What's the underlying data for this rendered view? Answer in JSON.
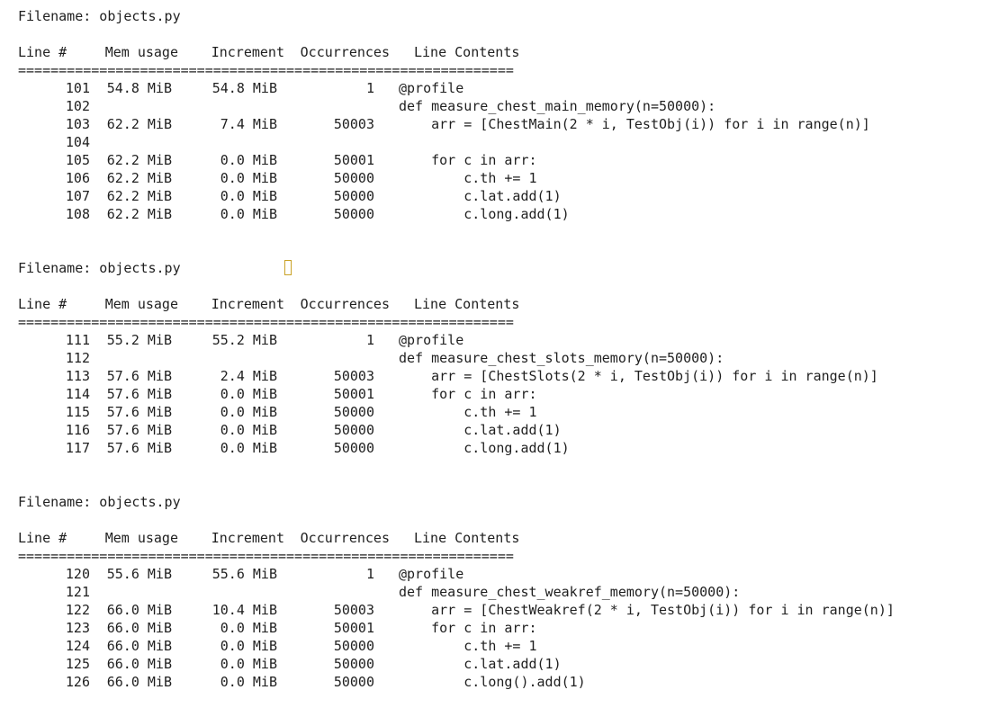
{
  "header": {
    "line_no": "Line #",
    "mem_usage": "Mem usage",
    "increment": "Increment",
    "occurrences": "Occurrences",
    "line_contents": "Line Contents",
    "separator": "============================================================="
  },
  "sections": [
    {
      "filename_label": "Filename: objects.py",
      "rows": [
        {
          "line": "101",
          "mem": "54.8 MiB",
          "incr": "54.8 MiB",
          "occ": "1",
          "code": "@profile"
        },
        {
          "line": "102",
          "mem": "",
          "incr": "",
          "occ": "",
          "code": "def measure_chest_main_memory(n=50000):"
        },
        {
          "line": "103",
          "mem": "62.2 MiB",
          "incr": "7.4 MiB",
          "occ": "50003",
          "code": "    arr = [ChestMain(2 * i, TestObj(i)) for i in range(n)]"
        },
        {
          "line": "104",
          "mem": "",
          "incr": "",
          "occ": "",
          "code": ""
        },
        {
          "line": "105",
          "mem": "62.2 MiB",
          "incr": "0.0 MiB",
          "occ": "50001",
          "code": "    for c in arr:"
        },
        {
          "line": "106",
          "mem": "62.2 MiB",
          "incr": "0.0 MiB",
          "occ": "50000",
          "code": "        c.th += 1"
        },
        {
          "line": "107",
          "mem": "62.2 MiB",
          "incr": "0.0 MiB",
          "occ": "50000",
          "code": "        c.lat.add(1)"
        },
        {
          "line": "108",
          "mem": "62.2 MiB",
          "incr": "0.0 MiB",
          "occ": "50000",
          "code": "        c.long.add(1)"
        }
      ]
    },
    {
      "filename_label": "Filename: objects.py",
      "rows": [
        {
          "line": "111",
          "mem": "55.2 MiB",
          "incr": "55.2 MiB",
          "occ": "1",
          "code": "@profile"
        },
        {
          "line": "112",
          "mem": "",
          "incr": "",
          "occ": "",
          "code": "def measure_chest_slots_memory(n=50000):"
        },
        {
          "line": "113",
          "mem": "57.6 MiB",
          "incr": "2.4 MiB",
          "occ": "50003",
          "code": "    arr = [ChestSlots(2 * i, TestObj(i)) for i in range(n)]"
        },
        {
          "line": "114",
          "mem": "57.6 MiB",
          "incr": "0.0 MiB",
          "occ": "50001",
          "code": "    for c in arr:"
        },
        {
          "line": "115",
          "mem": "57.6 MiB",
          "incr": "0.0 MiB",
          "occ": "50000",
          "code": "        c.th += 1"
        },
        {
          "line": "116",
          "mem": "57.6 MiB",
          "incr": "0.0 MiB",
          "occ": "50000",
          "code": "        c.lat.add(1)"
        },
        {
          "line": "117",
          "mem": "57.6 MiB",
          "incr": "0.0 MiB",
          "occ": "50000",
          "code": "        c.long.add(1)"
        }
      ]
    },
    {
      "filename_label": "Filename: objects.py",
      "rows": [
        {
          "line": "120",
          "mem": "55.6 MiB",
          "incr": "55.6 MiB",
          "occ": "1",
          "code": "@profile"
        },
        {
          "line": "121",
          "mem": "",
          "incr": "",
          "occ": "",
          "code": "def measure_chest_weakref_memory(n=50000):"
        },
        {
          "line": "122",
          "mem": "66.0 MiB",
          "incr": "10.4 MiB",
          "occ": "50003",
          "code": "    arr = [ChestWeakref(2 * i, TestObj(i)) for i in range(n)]"
        },
        {
          "line": "123",
          "mem": "66.0 MiB",
          "incr": "0.0 MiB",
          "occ": "50001",
          "code": "    for c in arr:"
        },
        {
          "line": "124",
          "mem": "66.0 MiB",
          "incr": "0.0 MiB",
          "occ": "50000",
          "code": "        c.th += 1"
        },
        {
          "line": "125",
          "mem": "66.0 MiB",
          "incr": "0.0 MiB",
          "occ": "50000",
          "code": "        c.lat.add(1)"
        },
        {
          "line": "126",
          "mem": "66.0 MiB",
          "incr": "0.0 MiB",
          "occ": "50000",
          "code": "        c.long().add(1)"
        }
      ]
    }
  ]
}
